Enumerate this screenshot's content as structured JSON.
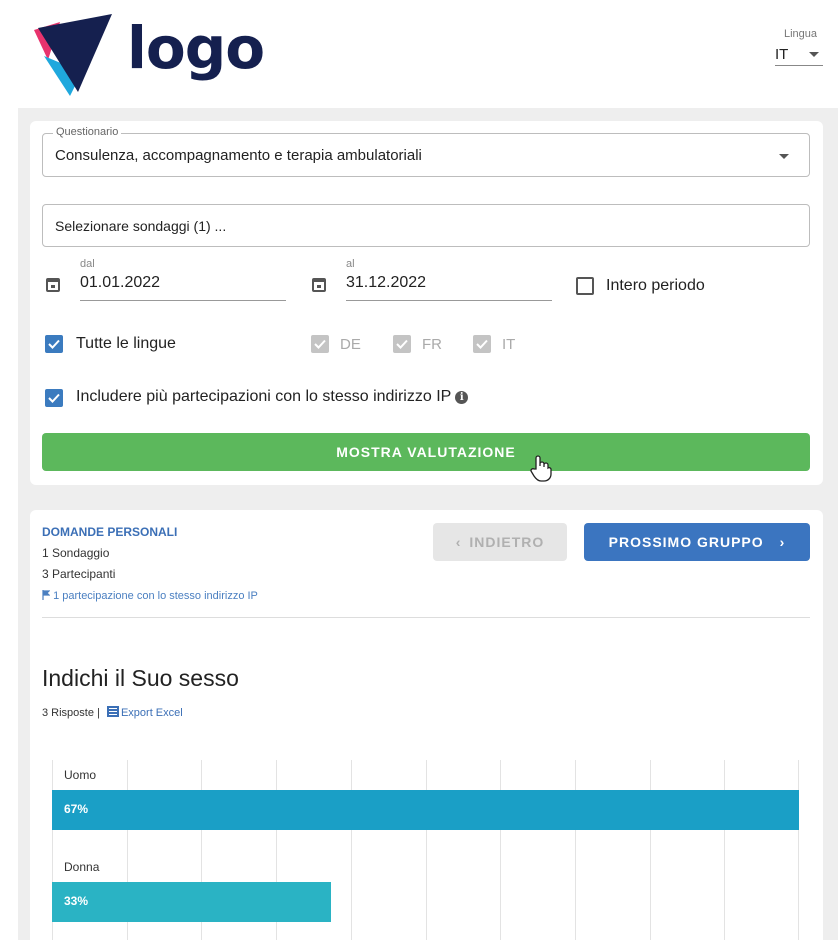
{
  "header": {
    "logo_text": "logo",
    "language_label": "Lingua",
    "language_value": "IT"
  },
  "filters": {
    "questionnaire_label": "Questionario",
    "questionnaire_value": "Consulenza, accompagnamento e terapia ambulatoriali",
    "surveys_value": "Selezionare sondaggi (1) ...",
    "date_from_label": "dal",
    "date_from_value": "01.01.2022",
    "date_to_label": "al",
    "date_to_value": "31.12.2022",
    "whole_period_label": "Intero periodo",
    "whole_period_checked": false,
    "all_languages_label": "Tutte le lingue",
    "all_languages_checked": true,
    "languages": [
      {
        "code": "DE",
        "checked": true,
        "disabled": true
      },
      {
        "code": "FR",
        "checked": true,
        "disabled": true
      },
      {
        "code": "IT",
        "checked": true,
        "disabled": true
      }
    ],
    "include_ip_label": "Includere più partecipazioni con lo stesso indirizzo IP",
    "include_ip_checked": true,
    "show_button": "MOSTRA VALUTAZIONE"
  },
  "group": {
    "title": "DOMANDE PERSONALI",
    "surveys": "1 Sondaggio",
    "participants": "3 Partecipanti",
    "ip_note": "1 partecipazione con lo stesso indirizzo IP",
    "back_button": "INDIETRO",
    "next_button": "PROSSIMO GRUPPO"
  },
  "question": {
    "title": "Indichi il Suo sesso",
    "responses": "3 Risposte |",
    "export_label": "Export Excel"
  },
  "colors": {
    "accent_blue": "#3b75c0",
    "green": "#5cb85c",
    "bar_uomo": "#1a9fc6",
    "bar_donna": "#2ab3c4"
  },
  "chart_data": {
    "type": "bar",
    "orientation": "horizontal",
    "categories": [
      "Uomo",
      "Donna"
    ],
    "values": [
      67,
      33
    ],
    "value_labels": [
      "67%",
      "33%"
    ],
    "unit": "%",
    "xlim": [
      0,
      100
    ],
    "grid": true
  }
}
